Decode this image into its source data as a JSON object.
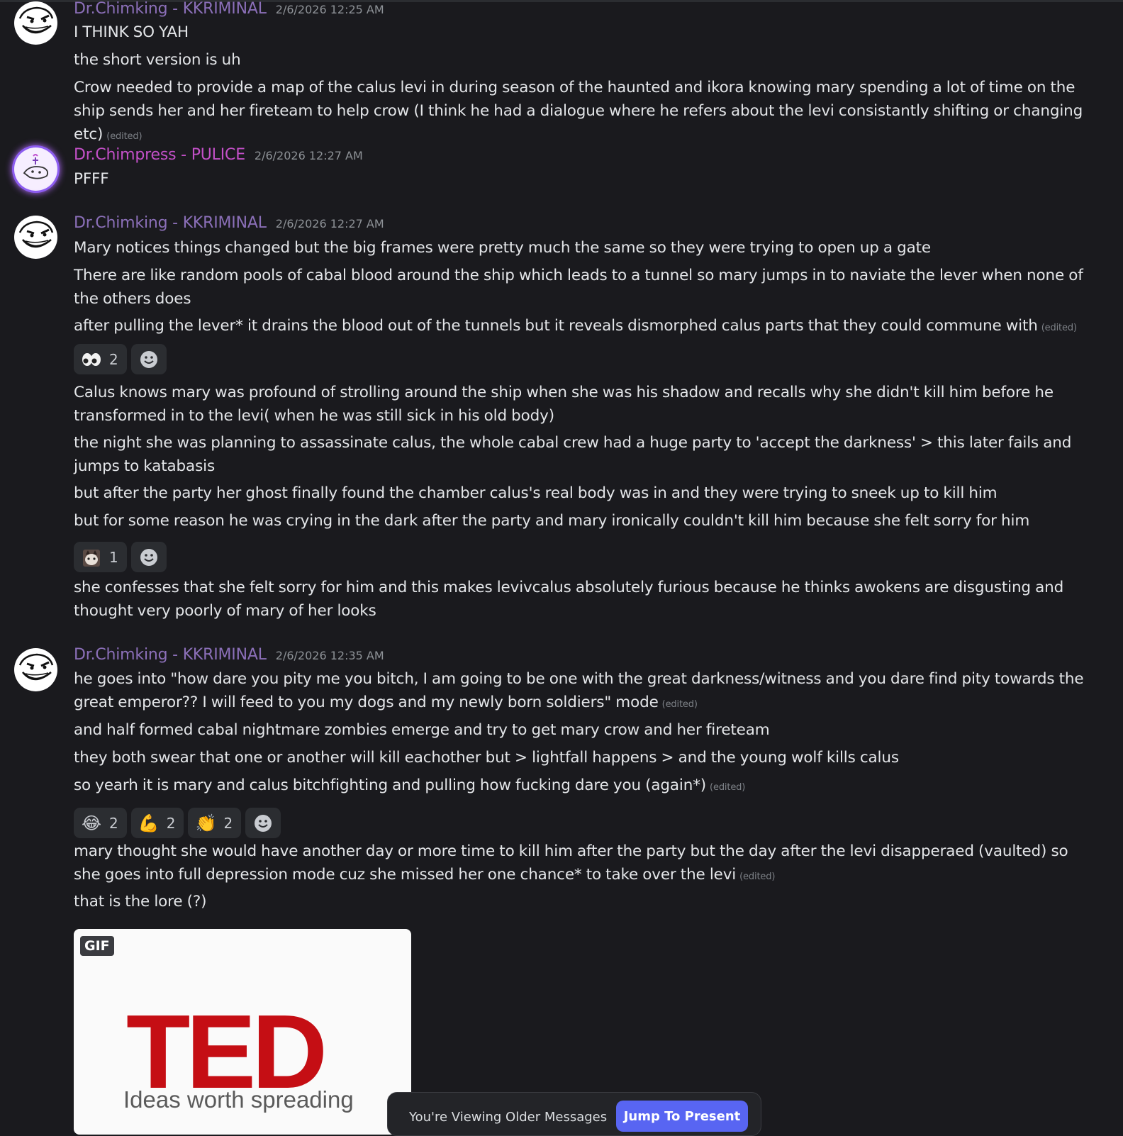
{
  "messages": [
    {
      "author": "Dr.Chimking - KKRIMINAL",
      "timestamp": "2/6/2026 12:25 AM",
      "lines": [
        {
          "text": "I THINK SO YAH",
          "edited": ""
        },
        {
          "text": "the short version is uh",
          "edited": ""
        },
        {
          "text": "Crow needed to provide a map of the calus levi in during season of the haunted and ikora knowing mary spending a lot of time on the ship sends her and her fireteam to help crow (I think he had a dialogue where he refers about the levi consistantly shifting or changing etc)",
          "edited": "(edited)"
        }
      ]
    },
    {
      "author": "Dr.Chimpress - PULICE",
      "timestamp": "2/6/2026 12:27 AM",
      "lines": [
        {
          "text": "PFFF",
          "edited": ""
        }
      ]
    },
    {
      "author": "Dr.Chimking - KKRIMINAL",
      "timestamp": "2/6/2026 12:27 AM",
      "lines": [
        {
          "text": "Mary notices things changed but the big frames were pretty much the same so they were trying to open up a gate",
          "edited": ""
        },
        {
          "text": "There are like random pools of cabal blood around the ship which leads to a tunnel so mary jumps in to naviate the lever when none of the others does",
          "edited": ""
        },
        {
          "text": "after pulling the lever* it drains the blood out of the tunnels but it reveals  dismorphed calus parts that they could commune with",
          "edited": "(edited)"
        },
        {
          "text": "Calus knows mary was profound of strolling around the ship when she was his shadow and recalls why she didn't kill him before he transformed in to the levi( when he was still sick in his old body)",
          "edited": ""
        },
        {
          "text": "the night she was planning to assassinate calus, the whole cabal crew had a huge party to 'accept the darkness' > this later fails and jumps to katabasis",
          "edited": ""
        },
        {
          "text": "but after the party her ghost finally found the chamber calus's real body was in and they were trying to sneek up to kill him",
          "edited": ""
        },
        {
          "text": "but for some reason he was crying in the dark after the party and mary ironically couldn't kill him because she felt sorry for him",
          "edited": ""
        },
        {
          "text": "she confesses that she felt sorry for him and this makes levivcalus absolutely furious because he thinks awokens are disgusting and thought very poorly of mary of her looks",
          "edited": ""
        }
      ],
      "reactions_a": [
        {
          "emoji": "eyes-emoji",
          "count": "2"
        }
      ],
      "reactions_b": [
        {
          "emoji": "cat-emoji",
          "count": "1"
        }
      ]
    },
    {
      "author": "Dr.Chimking - KKRIMINAL",
      "timestamp": "2/6/2026 12:35 AM",
      "lines": [
        {
          "text": "he goes into \"how dare you pity me you bitch, I am going to be one with the great darkness/witness  and you dare find pity towards the great emperor?? I will feed to you my dogs and my newly born soldiers\" mode",
          "edited": "(edited)"
        },
        {
          "text": "and half formed cabal nightmare zombies emerge and try to get mary crow and her fireteam",
          "edited": ""
        },
        {
          "text": "they both swear that one or another will kill eachother but > lightfall happens > and the young wolf kills calus",
          "edited": ""
        },
        {
          "text": "so yearh it is mary and calus bitchfighting and pulling how fucking dare you (again*)",
          "edited": "(edited)"
        },
        {
          "text": "mary thought she would have another day or more time to kill him after the party but the day after the levi disapperaed (vaulted) so she goes into full depression mode cuz she missed her one chance* to take over the levi",
          "edited": "(edited)"
        },
        {
          "text": "that is the lore (?)",
          "edited": ""
        }
      ],
      "reactions": [
        {
          "emoji": "joy-emoji",
          "glyph": "😂",
          "count": "2"
        },
        {
          "emoji": "flexed-biceps-emoji",
          "glyph": "💪",
          "count": "2"
        },
        {
          "emoji": "clapping-hands-emoji",
          "glyph": "👏",
          "count": "2"
        }
      ],
      "gif": {
        "badge": "GIF",
        "title": "TED",
        "subtitle": "Ideas worth spreading"
      }
    }
  ],
  "banner": {
    "text": "You're Viewing Older Messages",
    "button": "Jump To Present"
  },
  "colors": {
    "background": "#1a1a1e",
    "username_kkriminal": "#8b6fb8",
    "username_pulice": "#c350c8",
    "accent": "#5865f2",
    "ted_red": "#c50e14"
  }
}
